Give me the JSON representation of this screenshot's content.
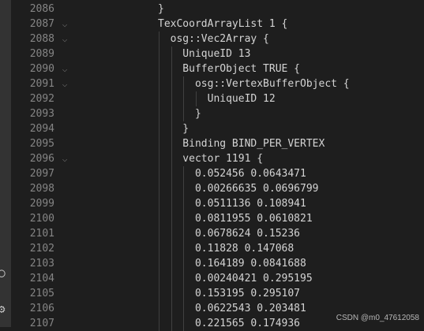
{
  "editor": {
    "lines": [
      {
        "num": "2086",
        "text": "}",
        "fold": false
      },
      {
        "num": "2087",
        "text": "TexCoordArrayList 1 {",
        "fold": true
      },
      {
        "num": "2088",
        "text": "  osg::Vec2Array {",
        "fold": true
      },
      {
        "num": "2089",
        "text": "    UniqueID 13",
        "fold": false
      },
      {
        "num": "2090",
        "text": "    BufferObject TRUE {",
        "fold": true
      },
      {
        "num": "2091",
        "text": "      osg::VertexBufferObject {",
        "fold": true
      },
      {
        "num": "2092",
        "text": "        UniqueID 12",
        "fold": false
      },
      {
        "num": "2093",
        "text": "      }",
        "fold": false
      },
      {
        "num": "2094",
        "text": "    }",
        "fold": false
      },
      {
        "num": "2095",
        "text": "    Binding BIND_PER_VERTEX",
        "fold": false
      },
      {
        "num": "2096",
        "text": "    vector 1191 {",
        "fold": true
      },
      {
        "num": "2097",
        "text": "      0.052456 0.0643471",
        "fold": false
      },
      {
        "num": "2098",
        "text": "      0.00266635 0.0696799",
        "fold": false
      },
      {
        "num": "2099",
        "text": "      0.0511136 0.108941",
        "fold": false
      },
      {
        "num": "2100",
        "text": "      0.0811955 0.0610821",
        "fold": false
      },
      {
        "num": "2101",
        "text": "      0.0678624 0.15236",
        "fold": false
      },
      {
        "num": "2102",
        "text": "      0.11828 0.147068",
        "fold": false
      },
      {
        "num": "2103",
        "text": "      0.164189 0.0841688",
        "fold": false
      },
      {
        "num": "2104",
        "text": "      0.00240421 0.295195",
        "fold": false
      },
      {
        "num": "2105",
        "text": "      0.153195 0.295107",
        "fold": false
      },
      {
        "num": "2106",
        "text": "      0.0622543 0.203481",
        "fold": false
      },
      {
        "num": "2107",
        "text": "      0.221565 0.174936",
        "fold": false
      }
    ]
  },
  "watermark": "CSDN @m0_47612058",
  "icons": {
    "fold": "chevron-down-icon",
    "activity": [
      "account-icon",
      "gear-icon"
    ]
  },
  "colors": {
    "background": "#1e1e1e",
    "line_number": "#858585",
    "code_text": "#d4d4d4"
  }
}
